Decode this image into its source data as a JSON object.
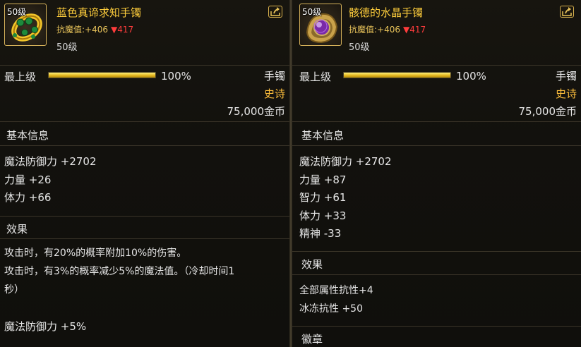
{
  "left": {
    "level_badge": "50级",
    "name": "蓝色真谛求知手镯",
    "resist_label": "抗魔值:",
    "resist_value": "+406",
    "resist_down": "▼417",
    "req_level": "50级",
    "grade_label": "最上级",
    "grade_percent": "100%",
    "grade_fill": 1.0,
    "type": "手镯",
    "rarity": "史诗",
    "price": "75,000金币",
    "basic_title": "基本信息",
    "stats": [
      "魔法防御力 +2702",
      "力量 +26",
      "体力 +66"
    ],
    "effect_title": "效果",
    "effect_lines": [
      "攻击时，有20%的概率附加10%的伤害。",
      "攻击时，有3%的概率减少5%的魔法值。（冷却时间1",
      "秒）",
      "",
      "魔法防御力 +5%"
    ],
    "icon": "gold-bracelet-icon"
  },
  "right": {
    "level_badge": "50级",
    "name": "骸德的水晶手镯",
    "resist_label": "抗魔值:",
    "resist_value": "+406",
    "resist_down": "▼417",
    "req_level": "50级",
    "grade_label": "最上级",
    "grade_percent": "100%",
    "grade_fill": 1.0,
    "type": "手镯",
    "rarity": "史诗",
    "price": "75,000金币",
    "basic_title": "基本信息",
    "stats": [
      "魔法防御力 +2702",
      "力量 +87",
      "智力 +61",
      "体力 +33",
      "精神 -33"
    ],
    "effect_title": "效果",
    "effect_lines": [
      "全部属性抗性+4",
      "冰冻抗性 +50"
    ],
    "badge_title": "徽章",
    "icon": "crystal-bracelet-icon"
  },
  "colors": {
    "item_name": "#ffce3c",
    "epic": "#ffbf3c",
    "down_arrow": "#ff3c3c",
    "frame": "#d6b25a"
  },
  "share_icon": "share-icon"
}
